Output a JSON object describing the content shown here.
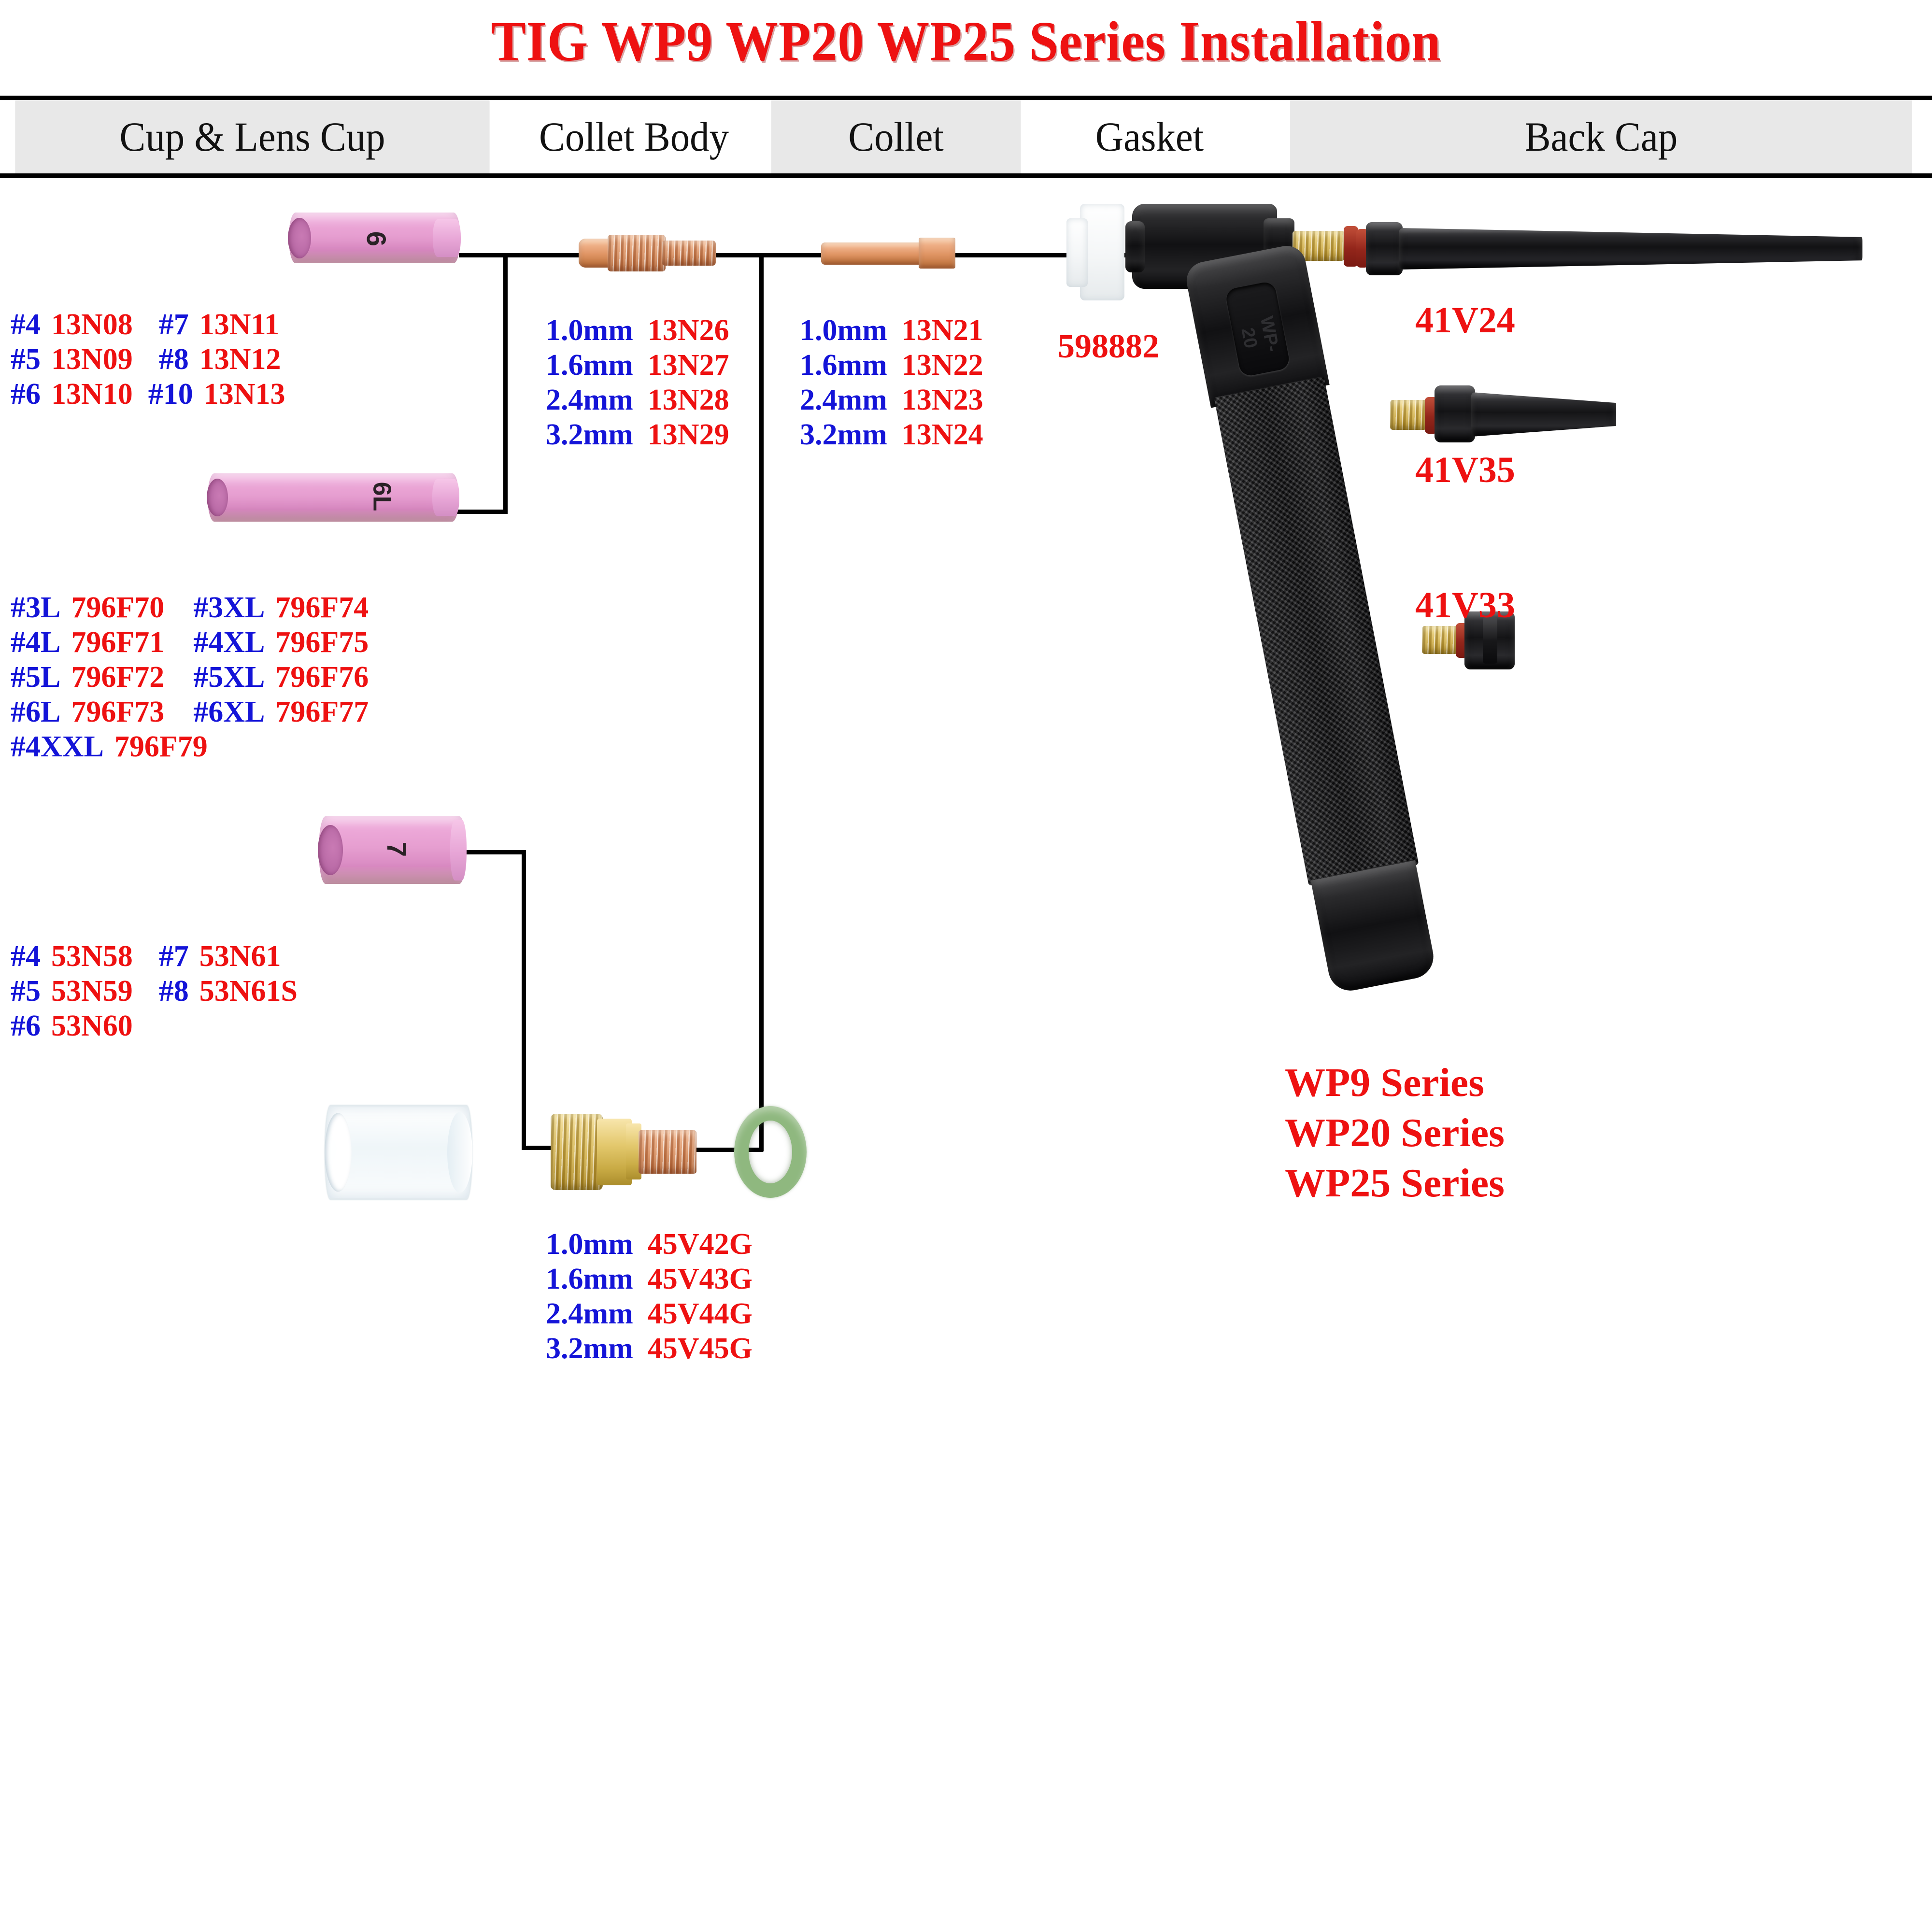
{
  "title": "TIG WP9 WP20 WP25 Series Installation",
  "colors": {
    "title_red": "#ee1111",
    "size_blue": "#1414d8",
    "part_red": "#ee1111",
    "header_fill": "#e8e8e8",
    "ceramic_pink": "#e69ed0",
    "copper": "#d98e5e",
    "brass": "#d4b34f",
    "oring_green": "#8fb87f",
    "oring_red": "#93261b",
    "torch_black": "#141416"
  },
  "header": {
    "columns": [
      {
        "label": "Cup & Lens Cup",
        "shaded": true
      },
      {
        "label": "Collet Body",
        "shaded": false
      },
      {
        "label": "Collet",
        "shaded": true
      },
      {
        "label": "Gasket",
        "shaded": false
      },
      {
        "label": "Back Cap",
        "shaded": true
      }
    ]
  },
  "parts": {
    "cup_standard": {
      "mark": "6"
    },
    "cup_long": {
      "mark": "6L"
    },
    "cup_gaslens": {
      "mark": "7"
    },
    "glass_cup": {
      "mark": ""
    }
  },
  "cup_standard_specs": {
    "rows": [
      {
        "left_size": "#4",
        "left_pn": "13N08",
        "right_size": "#7",
        "right_pn": "13N11"
      },
      {
        "left_size": "#5",
        "left_pn": "13N09",
        "right_size": "#8",
        "right_pn": "13N12"
      },
      {
        "left_size": "#6",
        "left_pn": "13N10",
        "right_size": "#10",
        "right_pn": "13N13"
      }
    ]
  },
  "cup_long_specs": {
    "rows": [
      {
        "left_size": "#3L",
        "left_pn": "796F70",
        "right_size": "#3XL",
        "right_pn": "796F74"
      },
      {
        "left_size": "#4L",
        "left_pn": "796F71",
        "right_size": "#4XL",
        "right_pn": "796F75"
      },
      {
        "left_size": "#5L",
        "left_pn": "796F72",
        "right_size": "#5XL",
        "right_pn": "796F76"
      },
      {
        "left_size": "#6L",
        "left_pn": "796F73",
        "right_size": "#6XL",
        "right_pn": "796F77"
      },
      {
        "left_size": "#4XXL",
        "left_pn": "796F79",
        "right_size": "",
        "right_pn": ""
      }
    ]
  },
  "cup_gaslens_specs": {
    "rows": [
      {
        "left_size": "#4",
        "left_pn": "53N58",
        "right_size": "#7",
        "right_pn": "53N61"
      },
      {
        "left_size": "#5",
        "left_pn": "53N59",
        "right_size": "#8",
        "right_pn": "53N61S"
      },
      {
        "left_size": "#6",
        "left_pn": "53N60",
        "right_size": "",
        "right_pn": ""
      }
    ]
  },
  "collet_body_specs": {
    "rows": [
      {
        "size": "1.0mm",
        "pn": "13N26"
      },
      {
        "size": "1.6mm",
        "pn": "13N27"
      },
      {
        "size": "2.4mm",
        "pn": "13N28"
      },
      {
        "size": "3.2mm",
        "pn": "13N29"
      }
    ]
  },
  "collet_specs": {
    "rows": [
      {
        "size": "1.0mm",
        "pn": "13N21"
      },
      {
        "size": "1.6mm",
        "pn": "13N22"
      },
      {
        "size": "2.4mm",
        "pn": "13N23"
      },
      {
        "size": "3.2mm",
        "pn": "13N24"
      }
    ]
  },
  "gas_lens_body_specs": {
    "rows": [
      {
        "size": "1.0mm",
        "pn": "45V42G"
      },
      {
        "size": "1.6mm",
        "pn": "45V43G"
      },
      {
        "size": "2.4mm",
        "pn": "45V44G"
      },
      {
        "size": "3.2mm",
        "pn": "45V45G"
      }
    ]
  },
  "gasket": {
    "pn": "598882"
  },
  "back_caps": [
    {
      "pn": "41V24",
      "length": "long"
    },
    {
      "pn": "41V35",
      "length": "medium"
    },
    {
      "pn": "41V33",
      "length": "short"
    }
  ],
  "series": {
    "lines": [
      "WP9 Series",
      "WP20 Series",
      "WP25 Series"
    ]
  },
  "torch": {
    "molded_text": "WP-20"
  }
}
